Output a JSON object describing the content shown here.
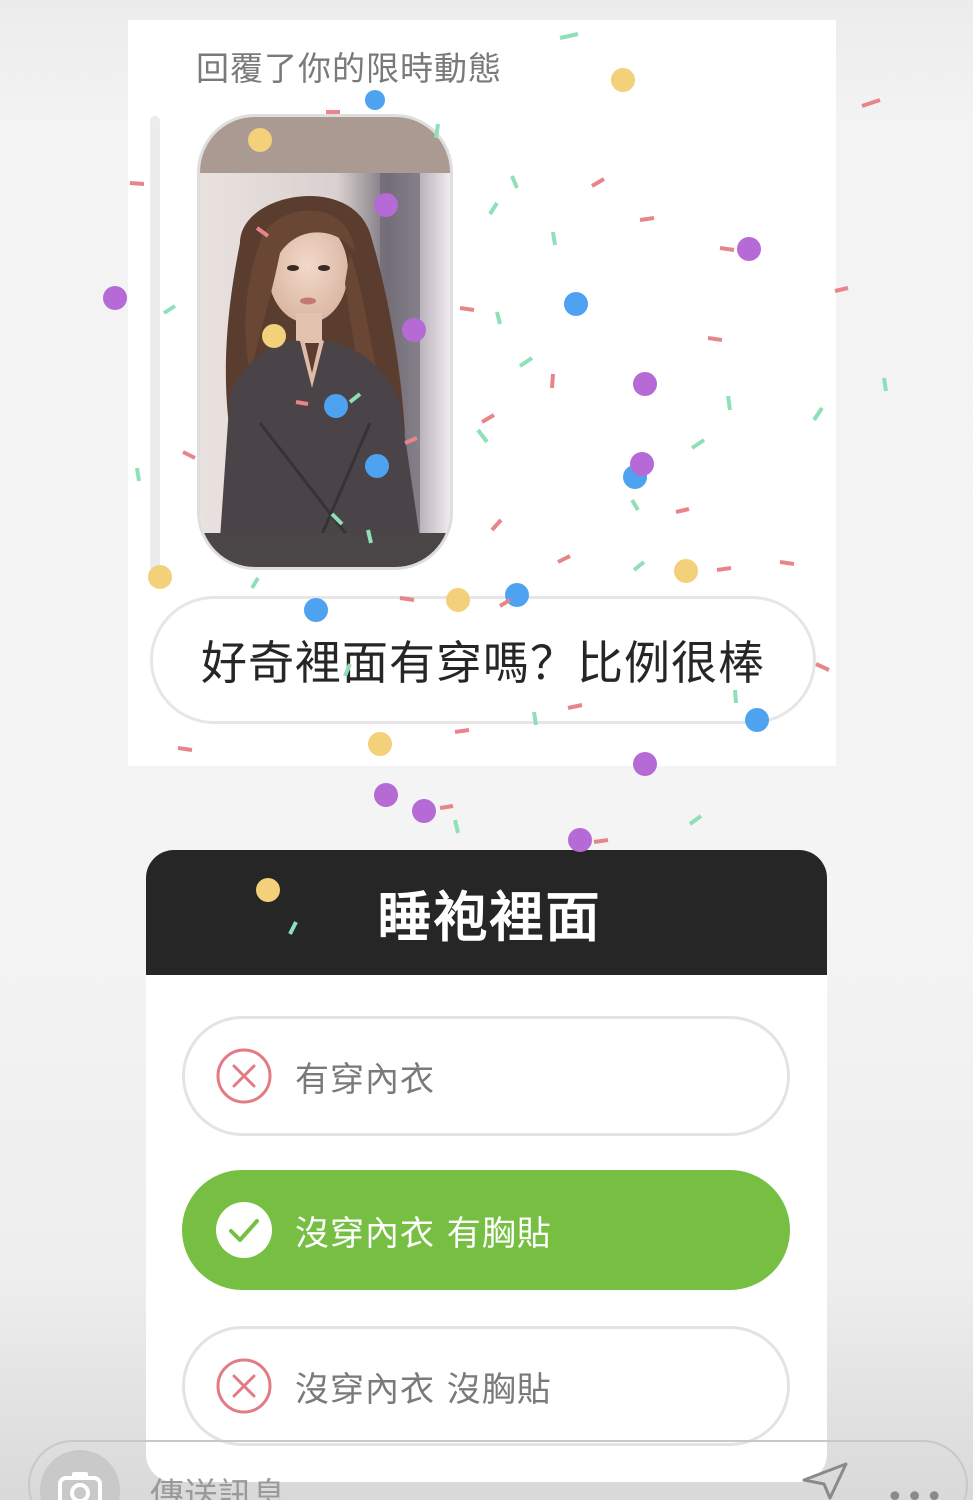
{
  "reply": {
    "label": "回覆了你的限時動態",
    "message": "好奇裡面有穿嗎？比例很棒"
  },
  "quiz": {
    "question": "睡袍裡面",
    "options": [
      {
        "label": "有穿內衣",
        "state": "wrong"
      },
      {
        "label": "沒穿內衣 有胸貼",
        "state": "correct"
      },
      {
        "label": "沒穿內衣 沒胸貼",
        "state": "wrong"
      }
    ]
  },
  "composer": {
    "placeholder": "傳送訊息",
    "camera_icon": "camera-icon",
    "send_icon": "send-icon",
    "more_icon": "more-icon"
  },
  "colors": {
    "correct": "#77bf43",
    "wrong": "#e27b84",
    "header": "#262626"
  }
}
